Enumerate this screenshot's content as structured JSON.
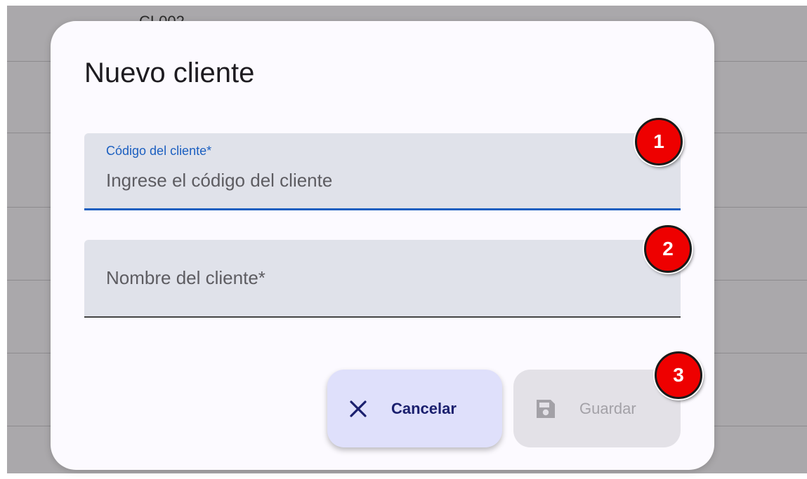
{
  "background": {
    "partial_text": "CL002"
  },
  "dialog": {
    "title": "Nuevo cliente",
    "code_field": {
      "label": "Código del cliente*",
      "placeholder": "Ingrese el código del cliente"
    },
    "name_field": {
      "placeholder": "Nombre del cliente*"
    },
    "buttons": {
      "cancel": {
        "label": "Cancelar",
        "icon": "close-icon"
      },
      "save": {
        "label": "Guardar",
        "icon": "floppy-disk-icon",
        "disabled": true
      }
    }
  },
  "markers": [
    "1",
    "2",
    "3"
  ],
  "colors": {
    "accent": "#1b5fc0",
    "marker": "#ee0000",
    "cancel_bg": "#dfe0fb",
    "save_bg_disabled": "#e3e1e7"
  }
}
